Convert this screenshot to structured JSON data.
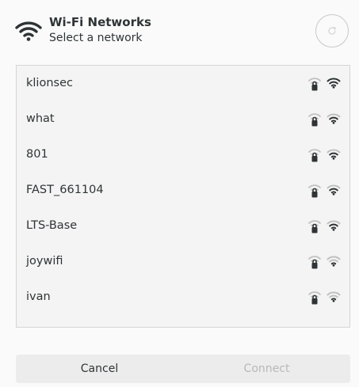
{
  "header": {
    "icon": "wifi-icon",
    "title": "Wi-Fi Networks",
    "subtitle": "Select a network",
    "refresh_icon": "refresh-icon"
  },
  "networks": [
    {
      "name": "klionsec",
      "secured": true,
      "signal_bars": 4
    },
    {
      "name": "what",
      "secured": true,
      "signal_bars": 3
    },
    {
      "name": "801",
      "secured": true,
      "signal_bars": 3
    },
    {
      "name": "FAST_661104",
      "secured": true,
      "signal_bars": 3
    },
    {
      "name": "LTS-Base",
      "secured": true,
      "signal_bars": 3
    },
    {
      "name": "joywifi",
      "secured": true,
      "signal_bars": 2
    },
    {
      "name": "ivan",
      "secured": true,
      "signal_bars": 2
    }
  ],
  "footer": {
    "cancel_label": "Cancel",
    "connect_label": "Connect",
    "connect_enabled": false
  },
  "colors": {
    "text": "#2e3436",
    "icon_dark": "#2e3436",
    "icon_faded": "#c0c0c0",
    "disabled_text": "#b8b8b8"
  }
}
